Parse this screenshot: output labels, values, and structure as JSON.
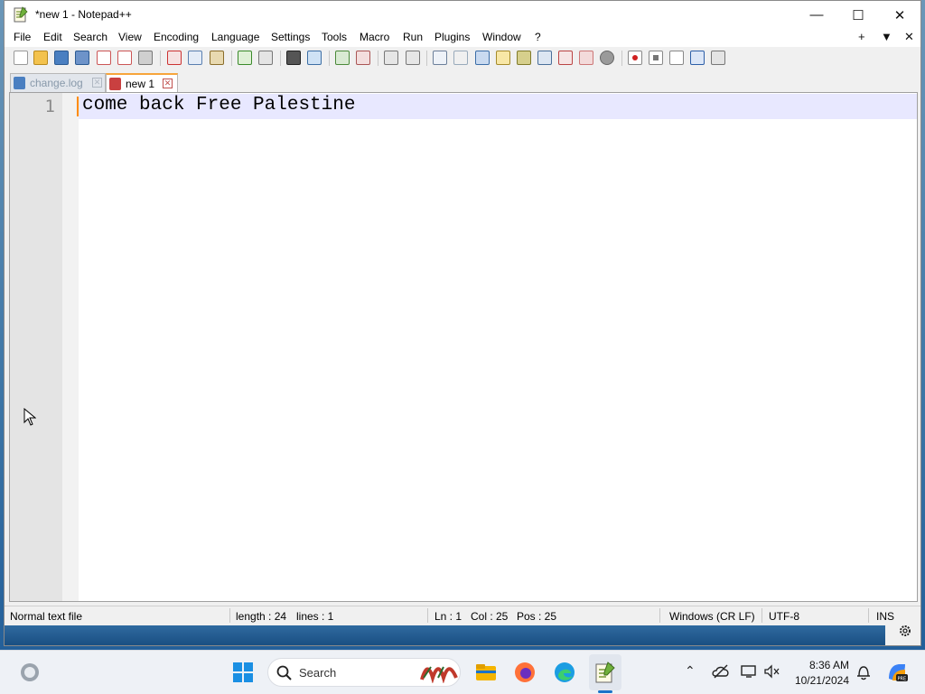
{
  "window": {
    "title": "*new 1 - Notepad++",
    "minimize_glyph": "—",
    "maximize_glyph": "☐",
    "close_glyph": "✕"
  },
  "menu": {
    "items": [
      "File",
      "Edit",
      "Search",
      "View",
      "Encoding",
      "Language",
      "Settings",
      "Tools",
      "Macro",
      "Run",
      "Plugins",
      "Window",
      "?"
    ],
    "right": [
      "+",
      "▼",
      "✕"
    ]
  },
  "toolbar": {
    "buttons": [
      "new-file-icon",
      "open-file-icon",
      "save-icon",
      "save-all-icon",
      "close-icon",
      "close-all-icon",
      "print-icon",
      "cut-icon",
      "copy-icon",
      "paste-icon",
      "undo-icon",
      "redo-icon",
      "find-icon",
      "replace-icon",
      "zoom-in-icon",
      "zoom-out-icon",
      "sync-vertical-icon",
      "sync-horizontal-icon",
      "word-wrap-icon",
      "show-all-characters-icon",
      "indent-guide-icon",
      "user-language-icon",
      "document-map-icon",
      "document-list-icon",
      "function-list-icon",
      "folder-as-workspace-icon",
      "monitoring-icon",
      "record-macro-icon",
      "stop-recording-icon",
      "playback-macro-icon",
      "run-macro-multiple-icon",
      "save-macro-icon"
    ]
  },
  "tabs": [
    {
      "label": "change.log",
      "active": false
    },
    {
      "label": "new 1",
      "active": true
    }
  ],
  "editor": {
    "line_number": "1",
    "line_text": "come back Free Palestine"
  },
  "status": {
    "file_type": "Normal text file",
    "length": "length : 24",
    "lines": "lines : 1",
    "ln": "Ln : 1",
    "col": "Col : 25",
    "pos": "Pos : 25",
    "eol": "Windows (CR LF)",
    "encoding": "UTF-8",
    "mode": "INS"
  },
  "taskbar": {
    "search_label": "Search",
    "time": "8:36 AM",
    "date": "10/21/2024"
  },
  "colors": {
    "accent": "#ff8c00",
    "current_line": "#e8e8ff",
    "gutter": "#e4e4e4"
  }
}
